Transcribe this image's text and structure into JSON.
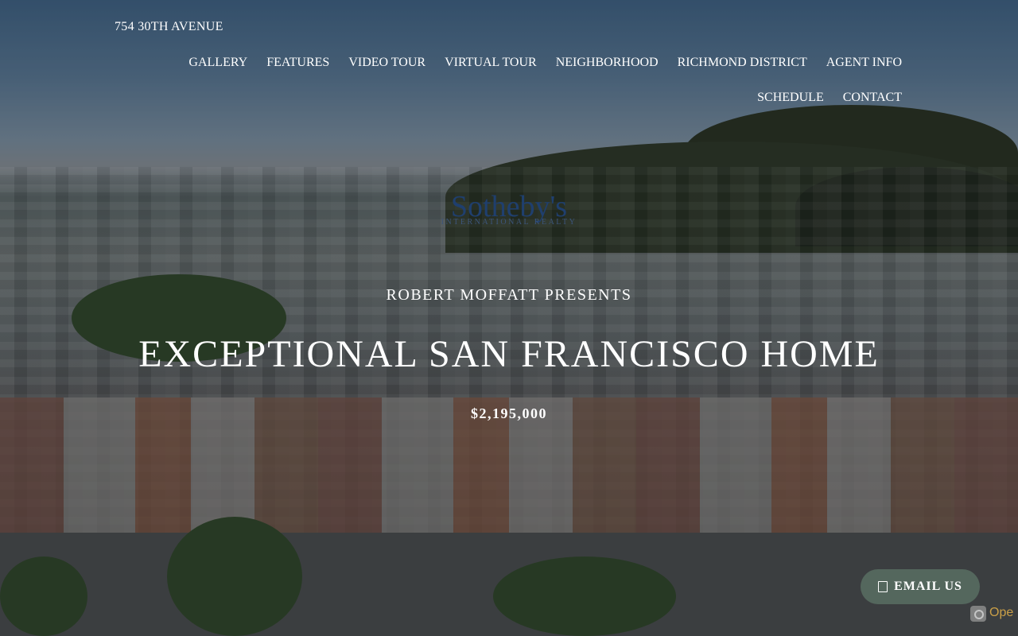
{
  "header": {
    "address": "754 30TH AVENUE",
    "nav": [
      "GALLERY",
      "FEATURES",
      "VIDEO TOUR",
      "VIRTUAL TOUR",
      "NEIGHBORHOOD",
      "RICHMOND DISTRICT",
      "AGENT INFO",
      "SCHEDULE",
      "CONTACT"
    ]
  },
  "brand": {
    "wordmark": "Sotheby's",
    "subtitle": "INTERNATIONAL REALTY"
  },
  "hero": {
    "presenter": "ROBERT MOFFATT PRESENTS",
    "headline": "EXCEPTIONAL SAN FRANCISCO HOME",
    "price": "$2,195,000"
  },
  "cta": {
    "email_label": "EMAIL US",
    "icon": "envelope-icon"
  },
  "corner_badge": {
    "text": "Ope",
    "icon": "camera-icon"
  }
}
